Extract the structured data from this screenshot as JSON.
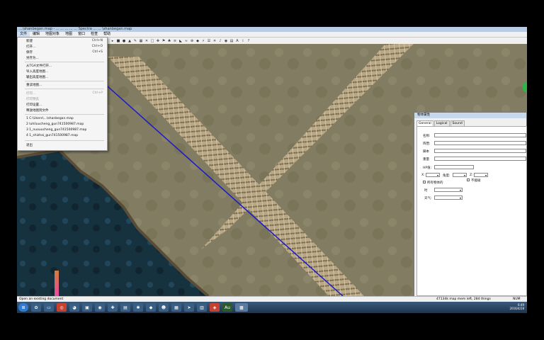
{
  "window": {
    "title": "...\\shanbegan.map - ...  ...  ...  ...  ... Spectra ...  ... \\shanbegan.map"
  },
  "menubar": [
    {
      "label": "文件"
    },
    {
      "label": "编辑"
    },
    {
      "label": "地图对象"
    },
    {
      "label": "地图"
    },
    {
      "label": "窗口"
    },
    {
      "label": "检查"
    },
    {
      "label": "帮助"
    }
  ],
  "file_menu": {
    "items": [
      {
        "label": "新建",
        "shortcut": "Ctrl+N"
      },
      {
        "label": "打开...",
        "shortcut": "Ctrl+O"
      },
      {
        "label": "保存",
        "shortcut": "Ctrl+S"
      },
      {
        "label": "另存为..."
      },
      {
        "label": "从TGA文件打开..."
      },
      {
        "label": "导入高度地图..."
      },
      {
        "label": "输出高度地图..."
      },
      {
        "label": "重读地图..."
      },
      {
        "label": "打印...",
        "shortcut": "Ctrl+P",
        "disabled": true
      },
      {
        "label": "打印预览",
        "disabled": true
      },
      {
        "label": "打印设置..."
      },
      {
        "label": "释放地图到文件"
      },
      {
        "label": "1 C:\\Users\\...\\shanbegan.map"
      },
      {
        "label": "2 luhiluucheng_gun741500987.map"
      },
      {
        "label": "3 1_nuouucheng_gun741500987.map"
      },
      {
        "label": "4 1_shizhai_gun741500987.map"
      },
      {
        "label": "退出"
      }
    ]
  },
  "props_panel": {
    "title": "物体属性",
    "tabs": [
      "General",
      "Logical",
      "Sound"
    ],
    "labels": {
      "name": "名称:",
      "team": "阵营:",
      "script": "脚本",
      "weight": "重量",
      "hp": "HP值:",
      "x": "X:",
      "angle": "角度:",
      "z": "Z:",
      "check1": "所有物体的",
      "check2": "不能碰",
      "time": "时",
      "weather": "天气:"
    }
  },
  "statusbar": {
    "left": "Open an existing document",
    "mem": "47134k map mem left, 284 things",
    "num": "NUM"
  },
  "tray": {
    "time": "6:49",
    "date": "2016/4/28"
  },
  "colors": {
    "titlebar": "#b8cde4",
    "taskbar": "#1d3550",
    "map_ground": "#6b6a55",
    "water": "#17323f",
    "blue_line": "#1a1acc"
  }
}
